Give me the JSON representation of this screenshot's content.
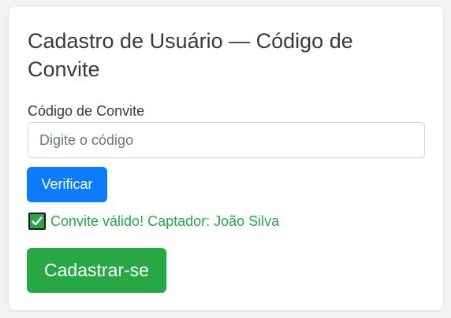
{
  "form": {
    "title": "Cadastro de Usuário — Código de Convite",
    "invite_label": "Código de Convite",
    "invite_input": {
      "value": "",
      "placeholder": "Digite o código"
    },
    "verify_label": "Verificar",
    "status": {
      "icon": "check-icon",
      "text": "Convite válido! Captador: João Silva"
    },
    "submit_label": "Cadastrar-se"
  },
  "colors": {
    "primary": "#0d7bff",
    "success": "#28a745",
    "background": "#f1f2f4",
    "card": "#ffffff"
  }
}
